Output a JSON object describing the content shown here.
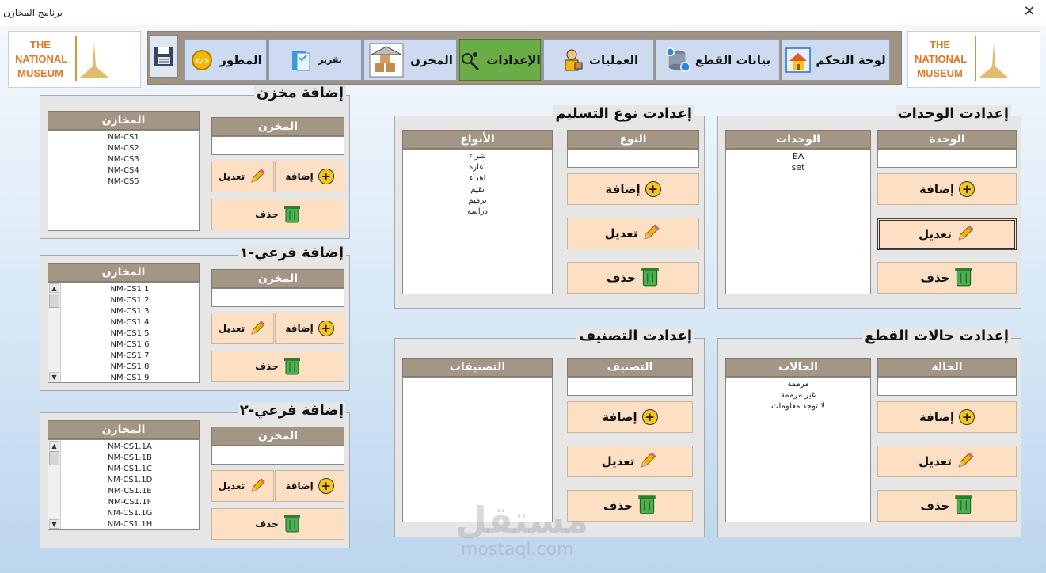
{
  "window": {
    "title": "برنامج المخازن",
    "close_glyph": "✕"
  },
  "logo": {
    "line1": "THE",
    "line2": "NATIONAL",
    "line3": "MUSEUM"
  },
  "nav": {
    "tabs": [
      {
        "label": "لوحة التحكم",
        "icon": "house-icon"
      },
      {
        "label": "بيانات القطع",
        "icon": "database-icon"
      },
      {
        "label": "العمليات",
        "icon": "worker-icon"
      },
      {
        "label": "الإعدادات",
        "icon": "tools-icon",
        "active": true
      },
      {
        "label": "المخزن",
        "icon": "warehouse-icon"
      },
      {
        "label": "تقرير",
        "icon": "report-icon"
      },
      {
        "label": "المطور",
        "icon": "code-gear-icon"
      }
    ],
    "save_icon": "floppy-disk-icon"
  },
  "buttons": {
    "add": "إضافة",
    "edit": "تعديل",
    "delete": "حذف"
  },
  "store": {
    "title": "إضافة مخزن",
    "list_header": "المخازن",
    "field_header": "المخزن",
    "items": [
      "NM-CS1",
      "NM-CS2",
      "NM-CS3",
      "NM-CS4",
      "NM-CS5"
    ]
  },
  "sub1": {
    "title": "إضافة فرعي-١",
    "list_header": "المخازن",
    "field_header": "المخزن",
    "items": [
      "NM-CS1.1",
      "NM-CS1.2",
      "NM-CS1.3",
      "NM-CS1.4",
      "NM-CS1.5",
      "NM-CS1.6",
      "NM-CS1.7",
      "NM-CS1.8",
      "NM-CS1.9"
    ]
  },
  "sub2": {
    "title": "إضافة فرعي-٢",
    "list_header": "المخازن",
    "field_header": "المخزن",
    "items": [
      "NM-CS1.1A",
      "NM-CS1.1B",
      "NM-CS1.1C",
      "NM-CS1.1D",
      "NM-CS1.1E",
      "NM-CS1.1F",
      "NM-CS1.1G",
      "NM-CS1.1H"
    ]
  },
  "delivery": {
    "title": "إعدادت نوع التسليم",
    "list_header": "الأنواع",
    "field_header": "النوع",
    "items": [
      "شراء",
      "اعارة",
      "اهداء",
      "تقيم",
      "ترميم",
      "دراسة"
    ]
  },
  "units": {
    "title": "إعدادت الوحدات",
    "list_header": "الوحدات",
    "field_header": "الوحدة",
    "items": [
      "EA",
      "set"
    ]
  },
  "classification": {
    "title": "إعدادت التصنيف",
    "list_header": "التصنيفات",
    "field_header": "التصنيف",
    "items": []
  },
  "states": {
    "title": "إعدادت حالات القطع",
    "list_header": "الحالات",
    "field_header": "الحالة",
    "items": [
      "مرممة",
      "غير مرممة",
      "لا توجد معلومات"
    ]
  },
  "watermark": {
    "text": "مستقل",
    "subtext": "mostaql.com"
  }
}
